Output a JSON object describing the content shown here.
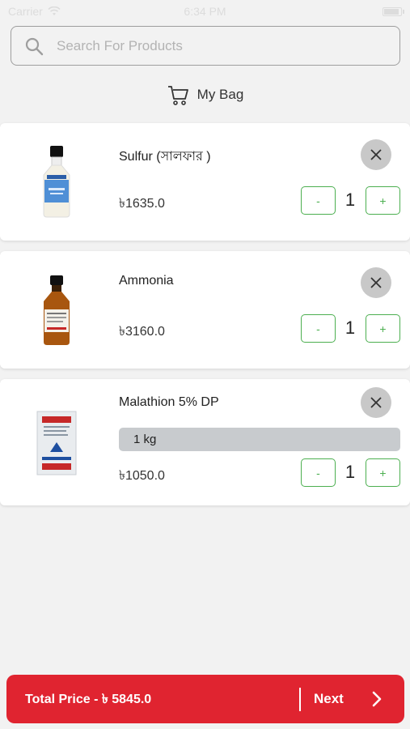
{
  "status_bar": {
    "carrier": "Carrier",
    "time": "6:34 PM"
  },
  "search": {
    "placeholder": "Search For Products",
    "value": ""
  },
  "header": {
    "title": "My Bag"
  },
  "cart": {
    "items": [
      {
        "name": "Sulfur (সালফার )",
        "price": "৳1635.0",
        "quantity": "1",
        "decrement_label": "-",
        "increment_label": "+"
      },
      {
        "name": "Ammonia",
        "price": "৳3160.0",
        "quantity": "1",
        "decrement_label": "-",
        "increment_label": "+"
      },
      {
        "name": "Malathion 5% DP",
        "variant": "1 kg",
        "price": "৳1050.0",
        "quantity": "1",
        "decrement_label": "-",
        "increment_label": "+"
      }
    ]
  },
  "footer": {
    "total_label": "Total Price - ৳ 5845.0",
    "next_label": "Next"
  },
  "colors": {
    "accent_red": "#e02430",
    "qty_green": "#4caf50",
    "remove_gray": "#c8c8c8"
  },
  "icons": {
    "search": "search-icon",
    "cart": "cart-icon",
    "remove": "close-icon",
    "next": "chevron-right-icon"
  }
}
